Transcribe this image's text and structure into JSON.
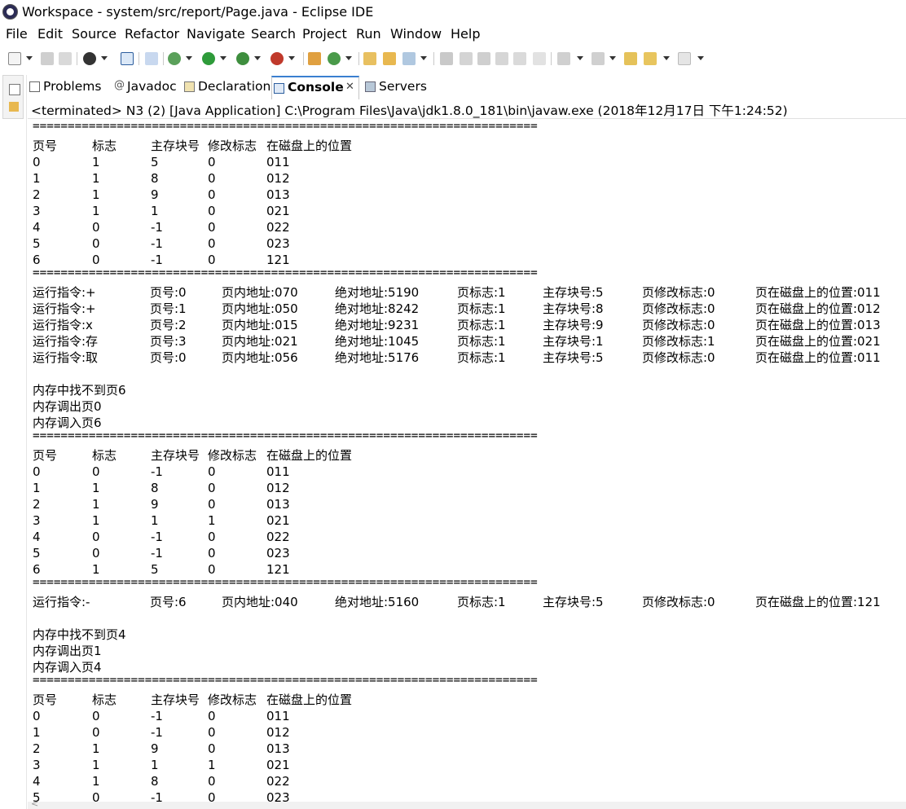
{
  "window": {
    "title": "Workspace - system/src/report/Page.java - Eclipse IDE"
  },
  "menu": [
    "File",
    "Edit",
    "Source",
    "Refactor",
    "Navigate",
    "Search",
    "Project",
    "Run",
    "Window",
    "Help"
  ],
  "tabs": [
    {
      "label": "Problems",
      "icon": "problems-icon"
    },
    {
      "label": "Javadoc",
      "icon": "javadoc-icon"
    },
    {
      "label": "Declaration",
      "icon": "declaration-icon"
    },
    {
      "label": "Console",
      "icon": "console-icon",
      "active": true
    },
    {
      "label": "Servers",
      "icon": "servers-icon"
    }
  ],
  "console": {
    "header": "<terminated> N3 (2) [Java Application] C:\\Program Files\\Java\\jdk1.8.0_181\\bin\\javaw.exe (2018年12月17日 下午1:24:52)",
    "separator": "========================================================================",
    "lines": [
      {
        "type": "sep"
      },
      {
        "type": "table",
        "cells": [
          "页号",
          "标志",
          "主存块号",
          "修改标志",
          "在磁盘上的位置"
        ]
      },
      {
        "type": "table",
        "cells": [
          "0",
          "1",
          "5",
          "0",
          "011"
        ]
      },
      {
        "type": "table",
        "cells": [
          "1",
          "1",
          "8",
          "0",
          "012"
        ]
      },
      {
        "type": "table",
        "cells": [
          "2",
          "1",
          "9",
          "0",
          "013"
        ]
      },
      {
        "type": "table",
        "cells": [
          "3",
          "1",
          "1",
          "0",
          "021"
        ]
      },
      {
        "type": "table",
        "cells": [
          "4",
          "0",
          "-1",
          "0",
          "022"
        ]
      },
      {
        "type": "table",
        "cells": [
          "5",
          "0",
          "-1",
          "0",
          "023"
        ]
      },
      {
        "type": "table",
        "cells": [
          "6",
          "0",
          "-1",
          "0",
          "121"
        ]
      },
      {
        "type": "sep"
      },
      {
        "type": "instr",
        "cells": [
          "运行指令:+",
          "页号:0",
          "页内地址:070",
          "绝对地址:5190",
          "页标志:1",
          "主存块号:5",
          "页修改标志:0",
          "页在磁盘上的位置:011"
        ]
      },
      {
        "type": "instr",
        "cells": [
          "运行指令:+",
          "页号:1",
          "页内地址:050",
          "绝对地址:8242",
          "页标志:1",
          "主存块号:8",
          "页修改标志:0",
          "页在磁盘上的位置:012"
        ]
      },
      {
        "type": "instr",
        "cells": [
          "运行指令:x",
          "页号:2",
          "页内地址:015",
          "绝对地址:9231",
          "页标志:1",
          "主存块号:9",
          "页修改标志:0",
          "页在磁盘上的位置:013"
        ]
      },
      {
        "type": "instr",
        "cells": [
          "运行指令:存",
          "页号:3",
          "页内地址:021",
          "绝对地址:1045",
          "页标志:1",
          "主存块号:1",
          "页修改标志:1",
          "页在磁盘上的位置:021"
        ]
      },
      {
        "type": "instr",
        "cells": [
          "运行指令:取",
          "页号:0",
          "页内地址:056",
          "绝对地址:5176",
          "页标志:1",
          "主存块号:5",
          "页修改标志:0",
          "页在磁盘上的位置:011"
        ]
      },
      {
        "type": "text",
        "text": ""
      },
      {
        "type": "text",
        "text": "内存中找不到页6"
      },
      {
        "type": "text",
        "text": "内存调出页0"
      },
      {
        "type": "text",
        "text": "内存调入页6"
      },
      {
        "type": "sep"
      },
      {
        "type": "table",
        "cells": [
          "页号",
          "标志",
          "主存块号",
          "修改标志",
          "在磁盘上的位置"
        ]
      },
      {
        "type": "table",
        "cells": [
          "0",
          "0",
          "-1",
          "0",
          "011"
        ]
      },
      {
        "type": "table",
        "cells": [
          "1",
          "1",
          "8",
          "0",
          "012"
        ]
      },
      {
        "type": "table",
        "cells": [
          "2",
          "1",
          "9",
          "0",
          "013"
        ]
      },
      {
        "type": "table",
        "cells": [
          "3",
          "1",
          "1",
          "1",
          "021"
        ]
      },
      {
        "type": "table",
        "cells": [
          "4",
          "0",
          "-1",
          "0",
          "022"
        ]
      },
      {
        "type": "table",
        "cells": [
          "5",
          "0",
          "-1",
          "0",
          "023"
        ]
      },
      {
        "type": "table",
        "cells": [
          "6",
          "1",
          "5",
          "0",
          "121"
        ]
      },
      {
        "type": "sep"
      },
      {
        "type": "instr",
        "cells": [
          "运行指令:-",
          "页号:6",
          "页内地址:040",
          "绝对地址:5160",
          "页标志:1",
          "主存块号:5",
          "页修改标志:0",
          "页在磁盘上的位置:121"
        ]
      },
      {
        "type": "text",
        "text": ""
      },
      {
        "type": "text",
        "text": "内存中找不到页4"
      },
      {
        "type": "text",
        "text": "内存调出页1"
      },
      {
        "type": "text",
        "text": "内存调入页4"
      },
      {
        "type": "sep"
      },
      {
        "type": "table",
        "cells": [
          "页号",
          "标志",
          "主存块号",
          "修改标志",
          "在磁盘上的位置"
        ]
      },
      {
        "type": "table",
        "cells": [
          "0",
          "0",
          "-1",
          "0",
          "011"
        ]
      },
      {
        "type": "table",
        "cells": [
          "1",
          "0",
          "-1",
          "0",
          "012"
        ]
      },
      {
        "type": "table",
        "cells": [
          "2",
          "1",
          "9",
          "0",
          "013"
        ]
      },
      {
        "type": "table",
        "cells": [
          "3",
          "1",
          "1",
          "1",
          "021"
        ]
      },
      {
        "type": "table",
        "cells": [
          "4",
          "1",
          "8",
          "0",
          "022"
        ]
      },
      {
        "type": "table",
        "cells": [
          "5",
          "0",
          "-1",
          "0",
          "023"
        ]
      }
    ]
  },
  "colors": {
    "active_tab_accent": "#3a7fd0"
  }
}
